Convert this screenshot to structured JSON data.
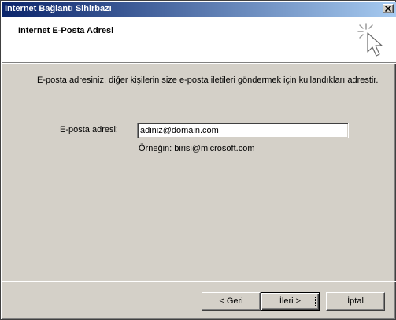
{
  "window": {
    "title": "Internet Bağlantı Sihirbazı"
  },
  "header": {
    "title": "Internet E-Posta Adresi",
    "icon": "wizard-sparkle-cursor-icon"
  },
  "body": {
    "description": "E-posta adresiniz, diğer kişilerin size e-posta iletileri göndermek için kullandıkları adrestir.",
    "email_label": "E-posta adresi:",
    "email_value": "adiniz@domain.com",
    "example": "Örneğin: birisi@microsoft.com"
  },
  "buttons": {
    "back": "< Geri",
    "next": "İleri >",
    "cancel": "İptal"
  },
  "colors": {
    "titlebar_start": "#0a246a",
    "titlebar_end": "#a6caf0",
    "face": "#d4d0c8"
  }
}
